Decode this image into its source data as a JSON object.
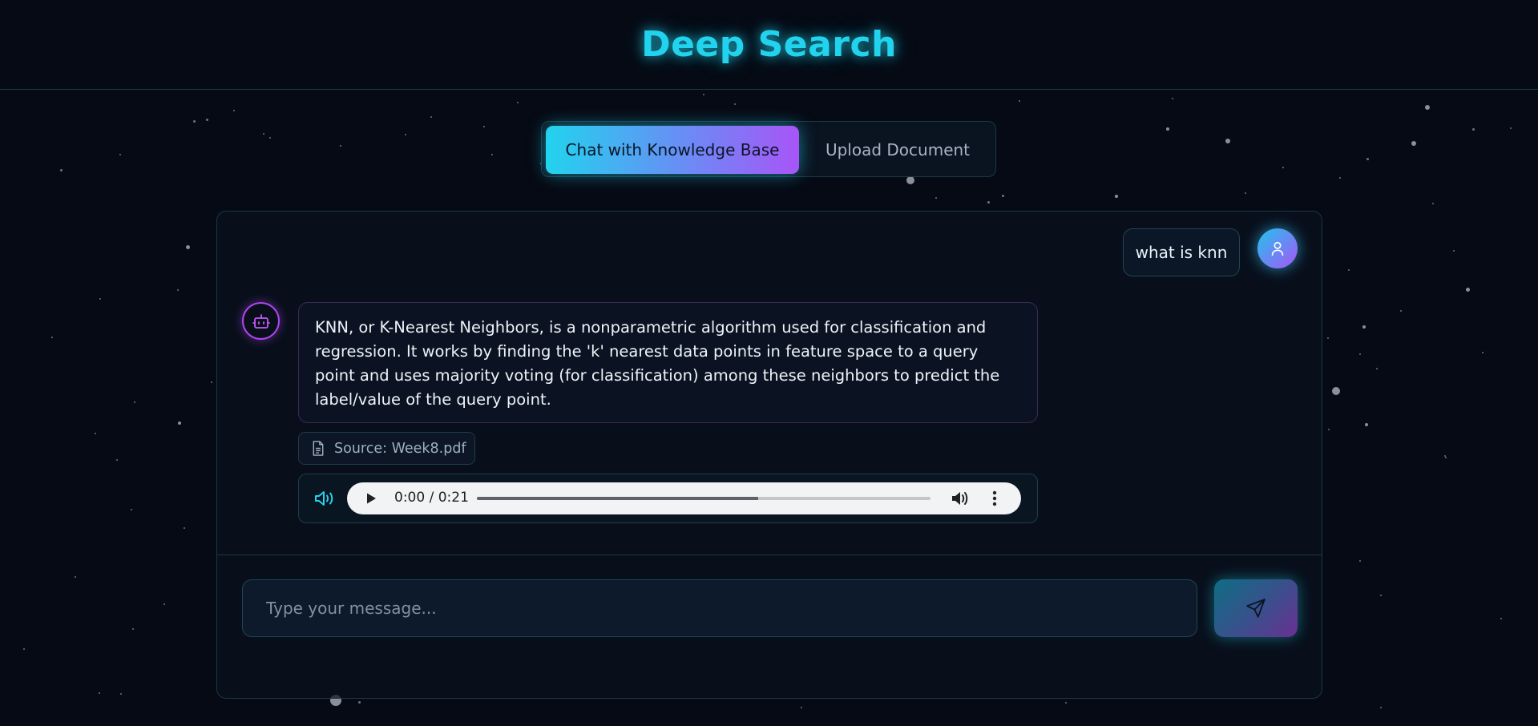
{
  "header": {
    "title": "Deep Search"
  },
  "tabs": [
    {
      "label": "Chat with Knowledge Base",
      "active": true
    },
    {
      "label": "Upload Document",
      "active": false
    }
  ],
  "chat": {
    "messages": [
      {
        "role": "user",
        "text": "what is knn"
      },
      {
        "role": "assistant",
        "text": "KNN, or K-Nearest Neighbors, is a nonparametric algorithm used for classification and regression. It works by finding the 'k' nearest data points in feature space to a query point and uses majority voting (for classification) among these neighbors to predict the label/value of the query point.",
        "source": "Source: Week8.pdf",
        "audio": {
          "time": "0:00 / 0:21",
          "buffered_fraction": 0.62
        }
      }
    ]
  },
  "input": {
    "placeholder": "Type your message...",
    "value": ""
  },
  "icons": {
    "user_avatar": "user-icon",
    "bot_avatar": "bot-icon",
    "source": "document-icon",
    "speaker": "speaker-icon",
    "play": "play-icon",
    "volume": "volume-icon",
    "more": "more-vertical-icon",
    "send": "send-icon"
  },
  "colors": {
    "accent_cyan": "#22d3ee",
    "accent_purple": "#a855f7",
    "background": "#060a14"
  }
}
